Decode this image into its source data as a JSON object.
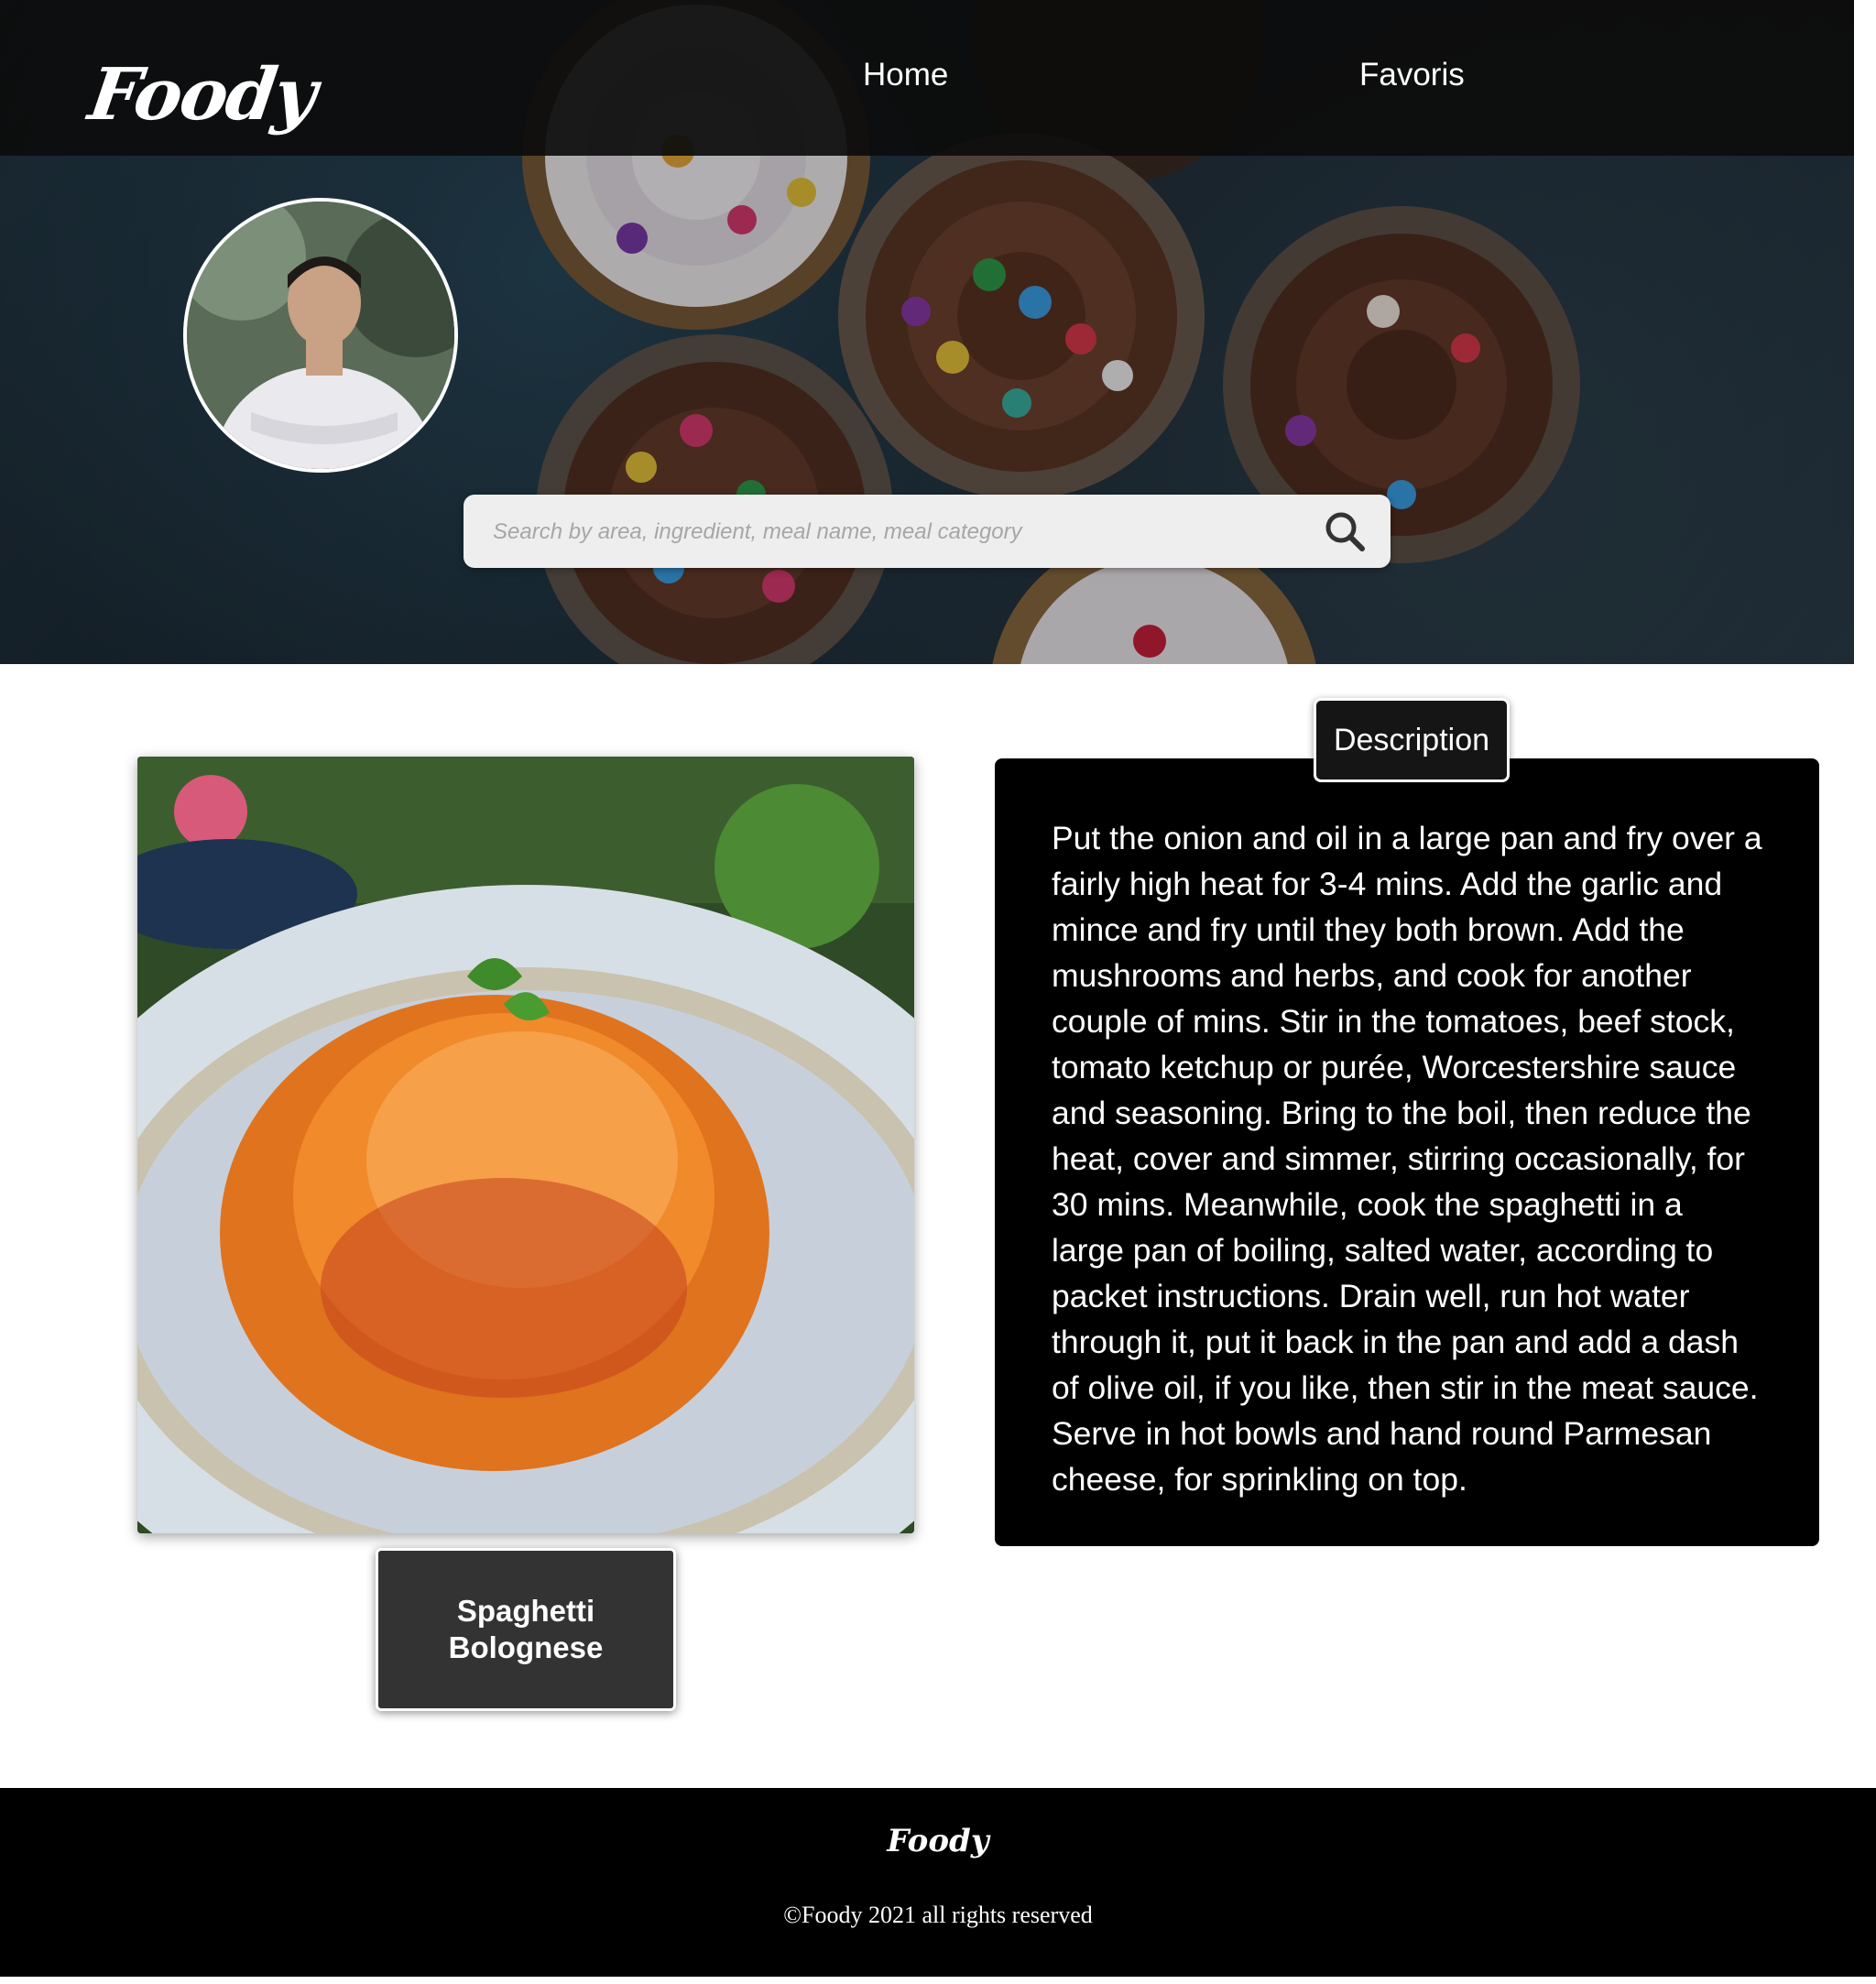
{
  "navbar": {
    "logo": "Foody",
    "links": [
      "Home",
      "Favoris"
    ]
  },
  "search": {
    "placeholder": "Search by area, ingredient, meal name, meal category",
    "icon": "search-icon"
  },
  "meal": {
    "name": "Spaghetti Bolognese",
    "description_tab": "Description",
    "description": "Put the onion and oil in a large pan and fry over a fairly high heat for 3-4 mins. Add the garlic and mince and fry until they both brown. Add the mushrooms and herbs, and cook for another couple of mins. Stir in the tomatoes, beef stock, tomato ketchup or purée, Worcestershire sauce and seasoning. Bring to the boil, then reduce the heat, cover and simmer, stirring occasionally, for 30 mins. Meanwhile, cook the spaghetti in a large pan of boiling, salted water, according to packet instructions. Drain well, run hot water through it, put it back in the pan and add a dash of olive oil, if you like, then stir in the meat sauce. Serve in hot bowls and hand round Parmesan cheese, for sprinkling on top."
  },
  "footer": {
    "logo": "Foody",
    "copyright": "©Foody 2021 all rights reserved"
  },
  "colors": {
    "navbar_bg": "#0c0c0c",
    "description_bg": "#000000",
    "meal_name_bg": "#333333",
    "footer_bg": "#000000",
    "search_bg": "#eeeeee"
  }
}
